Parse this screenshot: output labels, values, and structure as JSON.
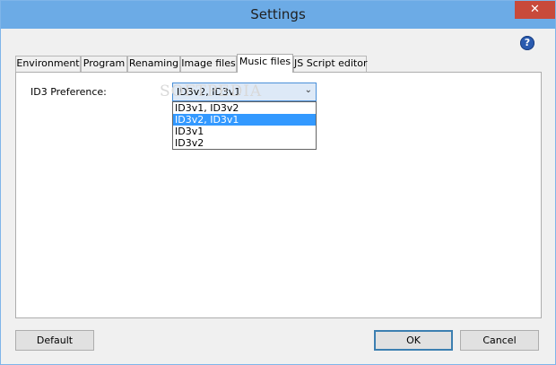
{
  "window": {
    "title": "Settings",
    "close_label": "✕"
  },
  "help": {
    "icon": "help-icon",
    "glyph": "?"
  },
  "tabs": [
    {
      "label": "Environment",
      "active": false
    },
    {
      "label": "Program",
      "active": false
    },
    {
      "label": "Renaming",
      "active": false
    },
    {
      "label": "Image files",
      "active": false
    },
    {
      "label": "Music files",
      "active": true
    },
    {
      "label": "JS Script editor",
      "active": false
    }
  ],
  "music": {
    "id3_label": "ID3 Preference:",
    "combo_value": "ID3v2, ID3v1",
    "combo_arrow": "⌄",
    "options": [
      "ID3v1, ID3v2",
      "ID3v2, ID3v1",
      "ID3v1",
      "ID3v2"
    ],
    "selected_index": 1
  },
  "watermark": "SOFTPEDIA",
  "buttons": {
    "default": "Default",
    "ok": "OK",
    "cancel": "Cancel"
  },
  "colors": {
    "titlebar": "#6cabe6",
    "close": "#c84a3b",
    "selection": "#3399ff"
  }
}
